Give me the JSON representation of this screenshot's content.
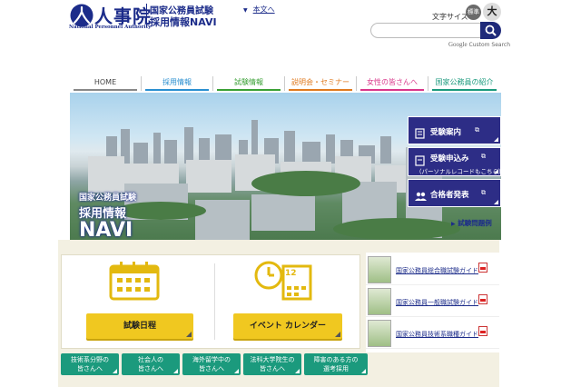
{
  "header": {
    "logo_text": "人事院",
    "logo_subtitle": "National Personnel Authority",
    "site_title_line1": "国家公務員試験",
    "site_title_line2": "採用情報NAVI",
    "skip_link": "本文へ",
    "font_size_label": "文字サイズ",
    "font_size_standard": "標準",
    "font_size_large": "大",
    "search_placeholder": "",
    "google_brand": "Google",
    "custom_search": "Custom Search"
  },
  "nav": {
    "items": [
      {
        "label": "HOME",
        "color": "#777777"
      },
      {
        "label": "採用情報",
        "color": "#2a8fd0"
      },
      {
        "label": "試験情報",
        "color": "#3aa035"
      },
      {
        "label": "説明会・セミナー",
        "color": "#e07a1f"
      },
      {
        "label": "女性の皆さんへ",
        "color": "#d9368a"
      },
      {
        "label": "国家公務員の紹介",
        "color": "#1b9a7d"
      }
    ]
  },
  "hero": {
    "title_small": "国家公務員試験",
    "title_mid": "採用情報",
    "title_large": "NAVI",
    "buttons": [
      {
        "label": "受験案内",
        "sub": ""
      },
      {
        "label": "受験申込み",
        "sub": "（パーソナルレコードもこちら）"
      },
      {
        "label": "合格者発表",
        "sub": ""
      }
    ],
    "qa_link": "試験問題例"
  },
  "panel": {
    "exam_schedule": "試験日程",
    "event_calendar": "イベント カレンダー",
    "calendar_day": "12"
  },
  "audience_buttons": [
    {
      "line1": "技術系分野の",
      "line2": "皆さんへ"
    },
    {
      "line1": "社会人の",
      "line2": "皆さんへ"
    },
    {
      "line1": "海外留学中の",
      "line2": "皆さんへ"
    },
    {
      "line1": "法科大学院生の",
      "line2": "皆さんへ"
    },
    {
      "line1": "障害のある方の",
      "line2": "選考採用"
    }
  ],
  "guides": [
    {
      "label": "国家公務員総合職試験ガイド"
    },
    {
      "label": "国家公務員一般職試験ガイド"
    },
    {
      "label": "国家公務員技術系職種ガイド"
    }
  ],
  "colors": {
    "brand_navy": "#1c2c8a",
    "hero_button": "#2d2d86",
    "yellow_button": "#f0c820",
    "green_button": "#1b9a7d"
  }
}
